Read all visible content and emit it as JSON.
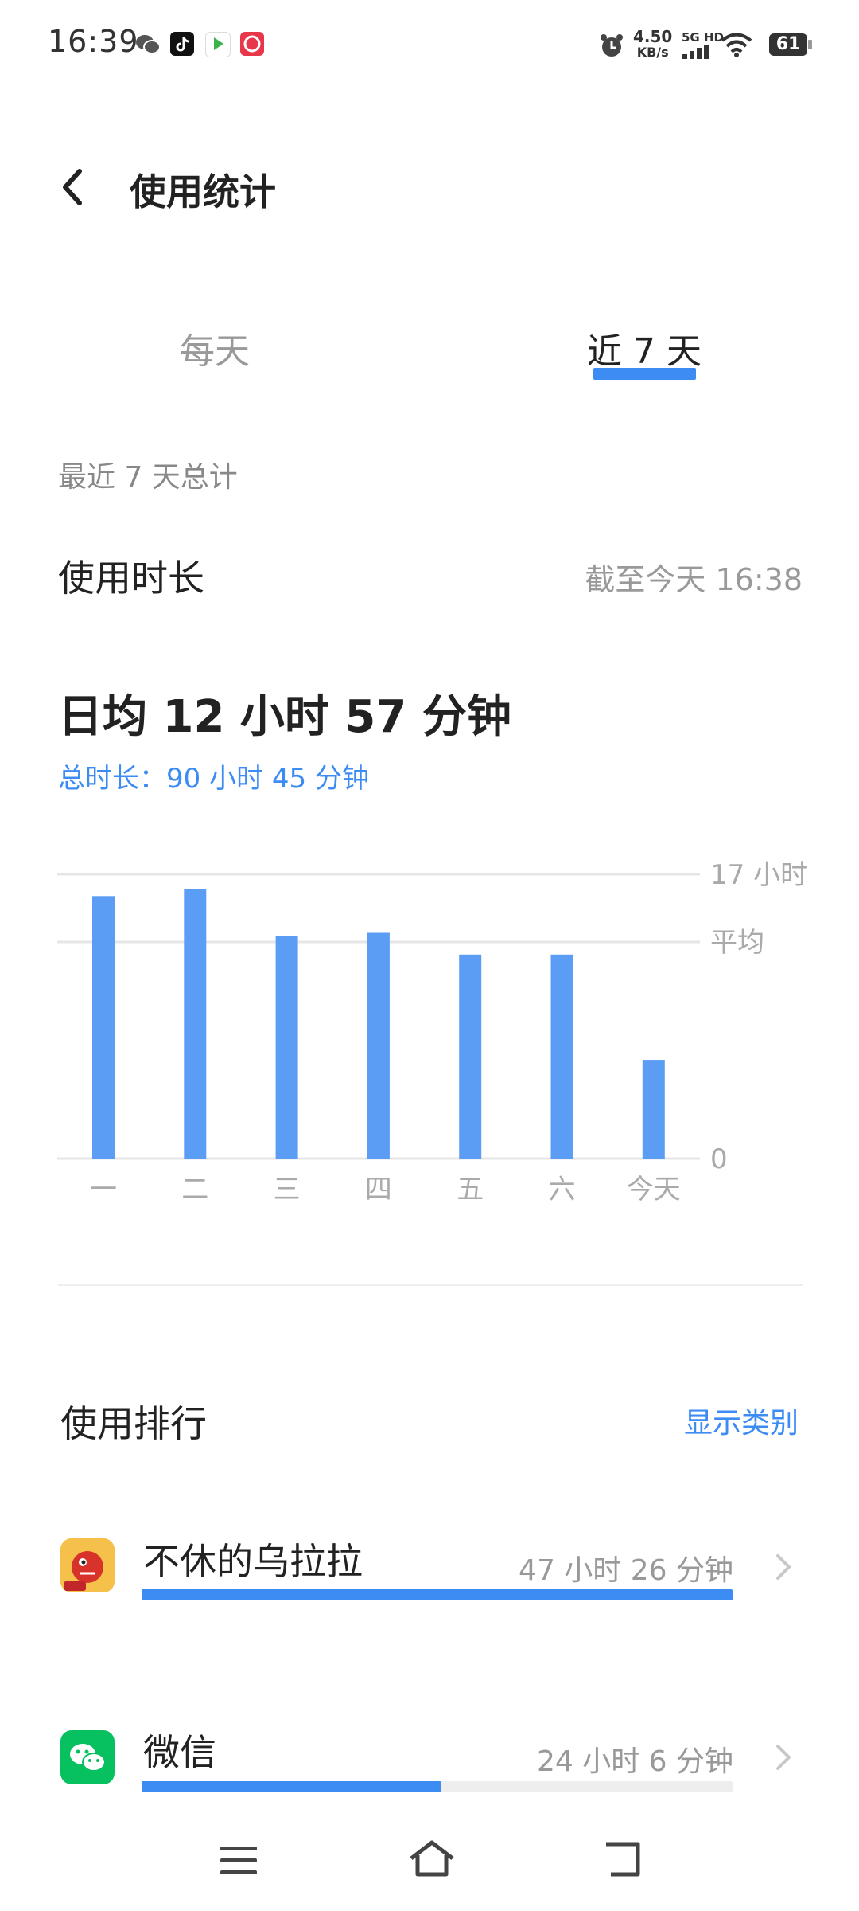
{
  "status_bar": {
    "time": "16:39",
    "net_speed_value": "4.50",
    "net_speed_unit": "KB/s",
    "net_type": "5G HD",
    "battery": "61",
    "notification_icons": [
      "wechat-icon",
      "tiktok-icon",
      "video-app-icon",
      "taobao-icon"
    ],
    "right_icons": [
      "alarm-icon",
      "signal-icon",
      "wifi-icon",
      "battery-icon"
    ]
  },
  "header": {
    "title": "使用统计",
    "back_icon": "back-arrow-icon"
  },
  "tabs": [
    {
      "label": "每天",
      "selected": false
    },
    {
      "label": "近 7 天",
      "selected": true
    }
  ],
  "summary": {
    "section_label": "最近 7 天总计",
    "duration_label": "使用时长",
    "as_of": "截至今天 16:38",
    "daily_average": "日均 12 小时 57 分钟",
    "total": "总时长：90 小时 45 分钟"
  },
  "chart_data": {
    "type": "bar",
    "categories": [
      "一",
      "二",
      "三",
      "四",
      "五",
      "六",
      "今天"
    ],
    "values": [
      15.7,
      16.1,
      13.3,
      13.5,
      12.2,
      12.2,
      5.9
    ],
    "ylim": [
      0,
      17
    ],
    "y_tick_labels": [
      {
        "value": 17,
        "label": "17 小时"
      },
      {
        "value": 12.95,
        "label": "平均"
      },
      {
        "value": 0,
        "label": "0"
      }
    ],
    "unit": "小时",
    "bar_color": "#5b9cf5"
  },
  "ranking": {
    "title": "使用排行",
    "show_category": "显示类别",
    "apps": [
      {
        "name": "不休的乌拉拉",
        "time": "47 小时 26 分钟",
        "fraction": 1.0,
        "icon": "urara-game-icon",
        "color": "#f2a03a"
      },
      {
        "name": "微信",
        "time": "24 小时 6 分钟",
        "fraction": 0.508,
        "icon": "wechat-app-icon",
        "color": "#07c160"
      }
    ]
  },
  "nav_bar": {
    "icons": [
      "menu-icon",
      "home-icon",
      "back-icon"
    ]
  },
  "colors": {
    "accent": "#3d8cf4",
    "bar": "#5b9cf5",
    "muted": "#999999"
  }
}
